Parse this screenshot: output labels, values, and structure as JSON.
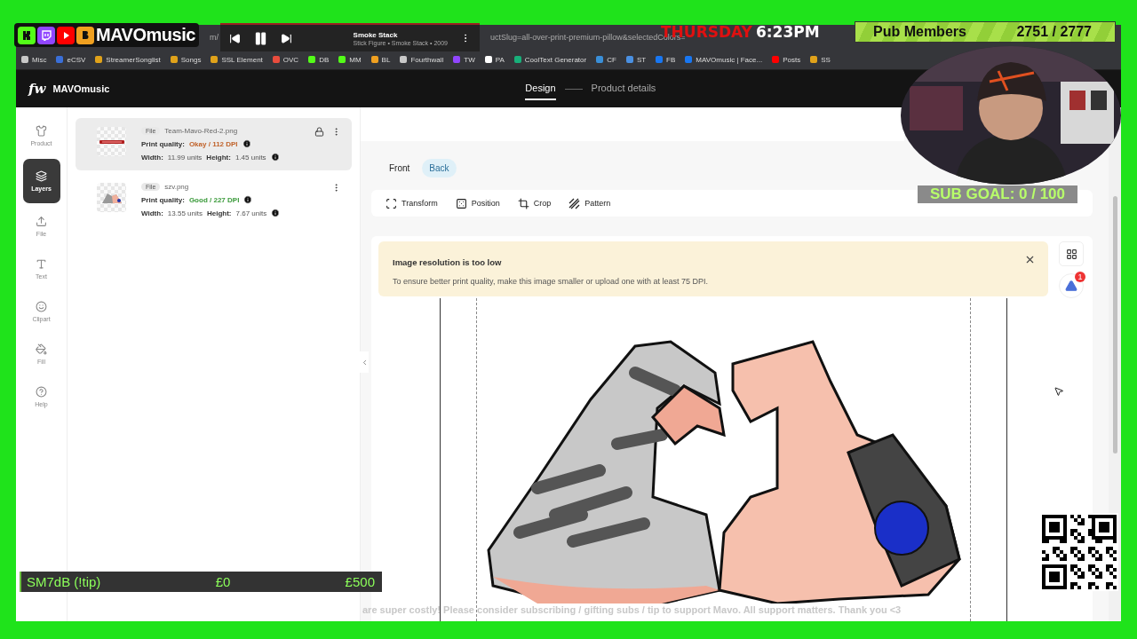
{
  "overlay": {
    "logo": {
      "title": "MAVOmusic",
      "platforms": [
        {
          "kind": "kick"
        },
        {
          "kind": "twitch"
        },
        {
          "kind": "youtube"
        },
        {
          "kind": "b"
        }
      ]
    },
    "player": {
      "track": "Smoke Stack",
      "details": "Stick Figure • Smoke Stack • 2009"
    },
    "clock": {
      "day": "THURSDAY",
      "time": "6:23PM"
    },
    "members": {
      "label": "Pub Members",
      "count": "2751 / 2777"
    },
    "sub_goal": "SUB GOAL: 0 / 100",
    "tip_goal": {
      "label": "SM7dB (!tip)",
      "current": "£0",
      "target": "£500",
      "level": 0
    },
    "ticker": "are super costly! Please consider subscribing / gifting subs / tip to support Mavo. All support matters. Thank you <3"
  },
  "browser": {
    "url_start": "m/",
    "url_end": "uctSlug=all-over-print-premium-pillow&selectedColors=",
    "bookmarks": [
      {
        "label": "Misc",
        "color": "#c8c8c8"
      },
      {
        "label": "eCSV",
        "color": "#3a6fd8"
      },
      {
        "label": "StreamerSonglist",
        "color": "#e0a21a"
      },
      {
        "label": "Songs",
        "color": "#e0a21a"
      },
      {
        "label": "SSL Element",
        "color": "#e0a21a"
      },
      {
        "label": "OVC",
        "color": "#e94c3d"
      },
      {
        "label": "DB",
        "color": "#53fc18"
      },
      {
        "label": "MM",
        "color": "#53fc18"
      },
      {
        "label": "BL",
        "color": "#f0a020"
      },
      {
        "label": "Fourthwall",
        "color": "#c8c8c8"
      },
      {
        "label": "TW",
        "color": "#9146ff"
      },
      {
        "label": "PA",
        "color": "#ffffff"
      },
      {
        "label": "CoolText Generator",
        "color": "#18b07a"
      },
      {
        "label": "CF",
        "color": "#3a8fd8"
      },
      {
        "label": "ST",
        "color": "#4a90e2"
      },
      {
        "label": "FB",
        "color": "#1877f2"
      },
      {
        "label": "MAVOmusic | Face...",
        "color": "#1877f2"
      },
      {
        "label": "Posts",
        "color": "#ff0000"
      },
      {
        "label": "SS",
        "color": "#e0a21a"
      }
    ]
  },
  "app": {
    "brand_mark": "fw",
    "brand": "MAVOmusic",
    "steps": [
      {
        "label": "Design",
        "selected": true
      },
      {
        "label": "Product details",
        "selected": false
      }
    ],
    "rail": [
      {
        "kind": "product",
        "label": "Product",
        "selected": false
      },
      {
        "kind": "layers",
        "label": "Layers",
        "selected": true
      },
      {
        "kind": "file",
        "label": "File",
        "selected": false
      },
      {
        "kind": "text",
        "label": "Text",
        "selected": false
      },
      {
        "kind": "clipart",
        "label": "Clipart",
        "selected": false
      },
      {
        "kind": "fill",
        "label": "Fill",
        "selected": false
      },
      {
        "kind": "help",
        "label": "Help",
        "selected": false
      }
    ],
    "layers": [
      {
        "tag": "File",
        "name": "Team-Mavo-Red-2.png",
        "quality_label": "Print quality:",
        "quality": "Okay / 112 DPI",
        "low_quality": true,
        "width_label": "Width:",
        "width": "11.99 units",
        "height_label": "Height:",
        "height": "1.45 units",
        "locked": true,
        "selected": true
      },
      {
        "tag": "File",
        "name": "szv.png",
        "quality_label": "Print quality:",
        "quality": "Good / 227 DPI",
        "low_quality": false,
        "width_label": "Width:",
        "width": "13.55 units",
        "height_label": "Height:",
        "height": "7.67 units",
        "locked": false,
        "selected": false
      }
    ],
    "sides": [
      {
        "label": "Front",
        "selected": false
      },
      {
        "label": "Back",
        "selected": true
      }
    ],
    "tools": [
      {
        "kind": "transform",
        "label": "Transform"
      },
      {
        "kind": "position",
        "label": "Position"
      },
      {
        "kind": "crop",
        "label": "Crop"
      },
      {
        "kind": "pattern",
        "label": "Pattern"
      }
    ],
    "alert": {
      "title": "Image resolution is too low",
      "message": "To ensure better print quality, make this image smaller or upload one with at least 75 DPI."
    },
    "warning_count": "1"
  }
}
